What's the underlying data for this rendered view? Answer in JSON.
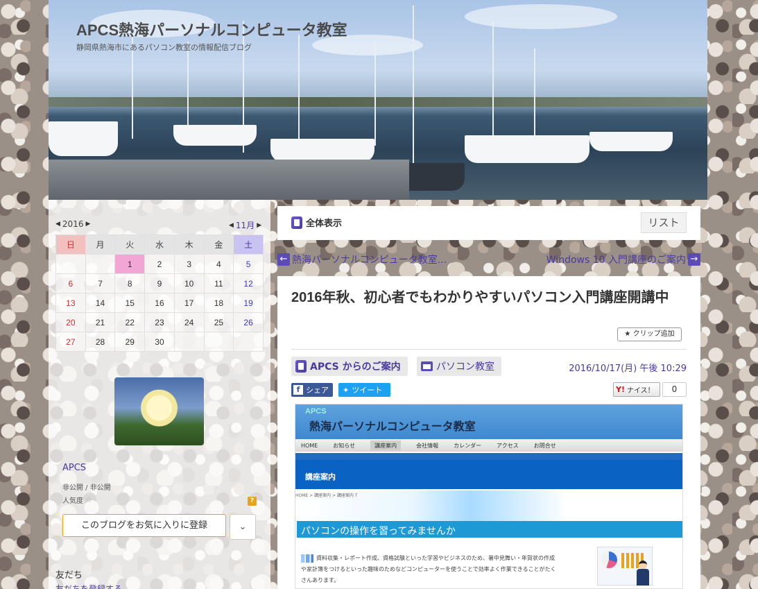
{
  "header": {
    "site_title": "APCS熱海パーソナルコンピュータ教室",
    "site_subtitle": "静岡県熱海市にあるパソコン教室の情報配信ブログ"
  },
  "calendar": {
    "year_label": "2016",
    "month_label": "11月",
    "weekdays": [
      "日",
      "月",
      "火",
      "水",
      "木",
      "金",
      "土"
    ],
    "weeks": [
      [
        "",
        "",
        "1",
        "2",
        "3",
        "4",
        "5"
      ],
      [
        "6",
        "7",
        "8",
        "9",
        "10",
        "11",
        "12"
      ],
      [
        "13",
        "14",
        "15",
        "16",
        "17",
        "18",
        "19"
      ],
      [
        "20",
        "21",
        "22",
        "23",
        "24",
        "25",
        "26"
      ],
      [
        "27",
        "28",
        "29",
        "30",
        "",
        "",
        ""
      ]
    ],
    "today": "1"
  },
  "profile": {
    "name": "APCS",
    "visibility": "非公開 / 非公開",
    "popularity_label": "人気度",
    "help_icon": "?",
    "favorite_button": "このブログをお気に入りに登録",
    "dropdown_icon": "chevron-down"
  },
  "friends": {
    "title": "友だち",
    "link": "友だちを登録する"
  },
  "toolbar": {
    "all_view": "全体表示",
    "list_button": "リスト"
  },
  "navigation": {
    "prev": "熱海パーソナルコンピュータ教室...",
    "next": "Windows 10 入門講座のご案内"
  },
  "article": {
    "title": "2016年秋、初心者でもわかりやすいパソコン入門講座開講中",
    "clip_button": "クリップ追加",
    "category": "APCS からのご案内",
    "folder": "パソコン教室",
    "date": "2016/10/17(月) 午後 10:29",
    "share_facebook": "シェア",
    "share_twitter": "ツイート",
    "nice_button": "ナイス！",
    "nice_count": "0"
  },
  "embedded_screenshot": {
    "logo": "APCS",
    "title": "熱海パーソナルコンピュータ教室",
    "menu": [
      "HOME",
      "お知らせ",
      "講座案内",
      "会社情報",
      "カレンダー",
      "アクセス",
      "お問合せ"
    ],
    "menu_active": "講座案内",
    "section_title": "講座案内",
    "breadcrumb": "HOME  >  講座案内  >  講座案内 T",
    "band_text": "パソコンの操作を習ってみませんか",
    "paragraph": "資料収集・レポート作成、資格試験といった学習やビジネスのため、暑中見舞い・年賀状の作成や家計簿をつけるといった趣味のためなどコンピューターを使うことで効率よく作業できることがたくさんあります。"
  },
  "colors": {
    "accent_purple": "#4a3aa0",
    "sunday_header": "#f3c0c0",
    "saturday_header": "#c9c3f2",
    "today_cell": "#f2a6d6",
    "favorite_border": "#e8a21c"
  }
}
